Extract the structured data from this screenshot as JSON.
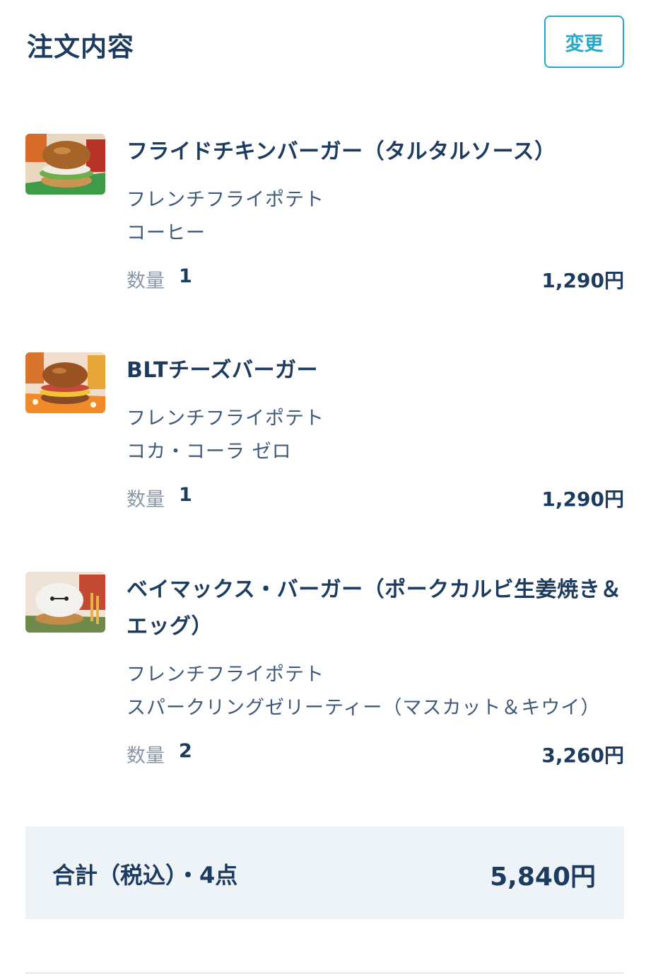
{
  "header": {
    "title": "注文内容",
    "change_label": "変更"
  },
  "items": [
    {
      "name": "フライドチキンバーガー（タルタルソース）",
      "options": [
        "フレンチフライポテト",
        "コーヒー"
      ],
      "qty_label": "数量",
      "qty": "1",
      "price": "1,290円"
    },
    {
      "name": "BLTチーズバーガー",
      "options": [
        "フレンチフライポテト",
        "コカ・コーラ ゼロ"
      ],
      "qty_label": "数量",
      "qty": "1",
      "price": "1,290円"
    },
    {
      "name": "ベイマックス・バーガー（ポークカルビ生姜焼き＆エッグ）",
      "options": [
        "フレンチフライポテト",
        "スパークリングゼリーティー（マスカット＆キウイ）"
      ],
      "qty_label": "数量",
      "qty": "2",
      "price": "3,260円"
    }
  ],
  "total": {
    "label": "合計（税込）・4点",
    "value": "5,840円"
  },
  "colors": {
    "accent": "#2aa6c8",
    "text": "#1c3b5e",
    "muted": "#8a97a8",
    "total_bg": "#eef3f8"
  }
}
